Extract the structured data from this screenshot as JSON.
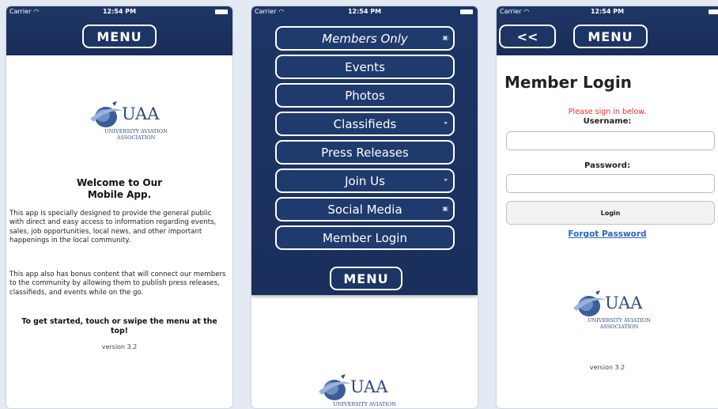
{
  "status_bar": {
    "carrier": "Carrier",
    "time": "12:54 PM",
    "wifi_icon": "wifi-icon",
    "battery_icon": "battery-icon"
  },
  "logo": {
    "name": "UAA",
    "org_line1": "UNIVERSITY AVIATION",
    "org_line2": "ASSOCIATION",
    "icon": "globe-plane-logo-icon"
  },
  "screen_home": {
    "menu_button": "MENU",
    "welcome_line1": "Welcome to Our",
    "welcome_line2": "Mobile App.",
    "paragraph1": "This app is specially designed to provide the general public with direct and easy access to information regarding events, sales, job opportunities, local news, and other important happenings in the local community.",
    "paragraph2": "This app also has bonus content that will connect our members to the community by allowing them to publish press releases, classifieds, and events while on the go.",
    "get_started": "To get started, touch or swipe the menu at the top!",
    "version": "version 3.2"
  },
  "screen_menu": {
    "items": [
      {
        "label": "Members Only",
        "badge": "lock-icon"
      },
      {
        "label": "Events",
        "badge": ""
      },
      {
        "label": "Photos",
        "badge": ""
      },
      {
        "label": "Classifieds",
        "badge": "link-icon"
      },
      {
        "label": "Press Releases",
        "badge": ""
      },
      {
        "label": "Join Us",
        "badge": "link-icon"
      },
      {
        "label": "Social Media",
        "badge": "lock-icon"
      },
      {
        "label": "Member Login",
        "badge": ""
      }
    ],
    "menu_button": "MENU"
  },
  "screen_login": {
    "back_button": "<<",
    "menu_button": "MENU",
    "title": "Member Login",
    "signin_message": "Please sign in below.",
    "username_label": "Username:",
    "username_value": "",
    "password_label": "Password:",
    "password_value": "",
    "login_button": "Login",
    "forgot_password": "Forgot Password",
    "version": "version 3.2"
  },
  "colors": {
    "nav_navy": "#1d3566",
    "page_background": "#e3eaf3",
    "error_red": "#e0302c",
    "link_blue": "#2b66b8",
    "logo_blue": "#2d4a7f"
  }
}
